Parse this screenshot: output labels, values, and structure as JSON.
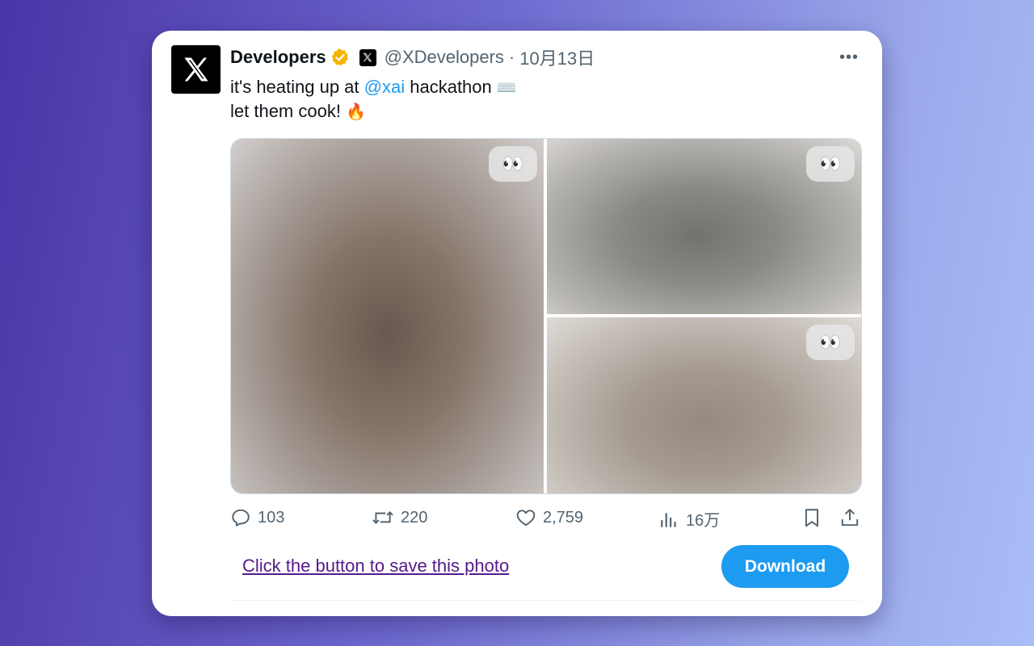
{
  "tweet": {
    "author_name": "Developers",
    "handle": "@XDevelopers",
    "separator": "·",
    "date": "10月13日",
    "text_line1_before": "it's heating up at ",
    "mention": "@xai",
    "text_line1_after": " hackathon ",
    "line1_emoji": "⌨️",
    "text_line2": "let them cook! ",
    "line2_emoji": "🔥",
    "more_label": "•••",
    "avatar_letter": "X",
    "media": [
      {
        "overlay": "👀"
      },
      {
        "overlay": "👀"
      },
      {
        "overlay": "👀"
      }
    ]
  },
  "actions": {
    "replies": "103",
    "retweets": "220",
    "likes": "2,759",
    "views": "16万"
  },
  "save_prompt": "Click the button to save this photo",
  "download_label": "Download",
  "colors": {
    "accent": "#1d9bf0",
    "verified": "#f4b400",
    "link_visited": "#551a8b"
  }
}
